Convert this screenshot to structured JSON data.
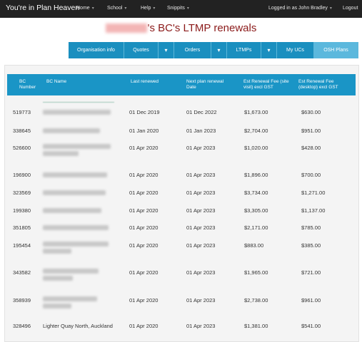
{
  "navbar": {
    "brand": "You're in Plan Heaven",
    "links": [
      {
        "label": "Home",
        "caret": "▾"
      },
      {
        "label": "School",
        "caret": "▾"
      },
      {
        "label": "Help",
        "caret": "▾"
      },
      {
        "label": "Snippits",
        "caret": "▾"
      }
    ],
    "user": "Logged in as John Bradley",
    "user_caret": "▾",
    "logout": "Logout"
  },
  "page": {
    "title_suffix": "'s BC's LTMP renewals",
    "title_color": "#8b1a1a"
  },
  "tabs": [
    {
      "label": "Organisation info"
    },
    {
      "label": "Quotes"
    },
    {
      "label": "Orders"
    },
    {
      "label": "LTMPs"
    },
    {
      "label": "My UCs"
    },
    {
      "label": "OSH Plans"
    }
  ],
  "tab_caret": "▾",
  "table": {
    "headers": {
      "bc_number": "BC Number",
      "bc_name": "BC Name",
      "last_renewed": "Last renewed",
      "next_renewal": "Next plan renewal Date",
      "fee_site": "Est Renewal Fee (site visit) excl GST",
      "fee_desktop": "Est Renewal Fee (desktop) excl GST"
    },
    "rows": [
      {
        "bc": "519773",
        "name": "",
        "last": "01 Dec 2019",
        "next": "01 Dec 2022",
        "site": "$1,673.00",
        "desk": "$630.00"
      },
      {
        "bc": "338645",
        "name": "",
        "last": "01 Jan 2020",
        "next": "01 Jan 2023",
        "site": "$2,704.00",
        "desk": "$951.00"
      },
      {
        "bc": "526600",
        "name": "",
        "last": "01 Apr 2020",
        "next": "01 Apr 2023",
        "site": "$1,020.00",
        "desk": "$428.00"
      },
      {
        "bc": "196900",
        "name": "",
        "last": "01 Apr 2020",
        "next": "01 Apr 2023",
        "site": "$1,896.00",
        "desk": "$700.00"
      },
      {
        "bc": "323569",
        "name": "",
        "last": "01 Apr 2020",
        "next": "01 Apr 2023",
        "site": "$3,734.00",
        "desk": "$1,271.00"
      },
      {
        "bc": "199380",
        "name": "",
        "last": "01 Apr 2020",
        "next": "01 Apr 2023",
        "site": "$3,305.00",
        "desk": "$1,137.00"
      },
      {
        "bc": "351805",
        "name": "",
        "last": "01 Apr 2020",
        "next": "01 Apr 2023",
        "site": "$2,171.00",
        "desk": "$785.00"
      },
      {
        "bc": "195454",
        "name": "",
        "last": "01 Apr 2020",
        "next": "01 Apr 2023",
        "site": "$883.00",
        "desk": "$385.00"
      },
      {
        "bc": "343582",
        "name": "",
        "last": "01 Apr 2020",
        "next": "01 Apr 2023",
        "site": "$1,965.00",
        "desk": "$721.00"
      },
      {
        "bc": "358939",
        "name": "",
        "last": "01 Apr 2020",
        "next": "01 Apr 2023",
        "site": "$2,738.00",
        "desk": "$961.00"
      },
      {
        "bc": "328496",
        "name": "Lighter Quay North, Auckland",
        "last": "01 Apr 2020",
        "next": "01 Apr 2023",
        "site": "$1,381.00",
        "desk": "$541.00"
      }
    ]
  },
  "colors": {
    "navbar": "#222222",
    "accent": "#1a8fbf",
    "active_tab": "#5bb8dd",
    "header": "#1a95c6"
  }
}
